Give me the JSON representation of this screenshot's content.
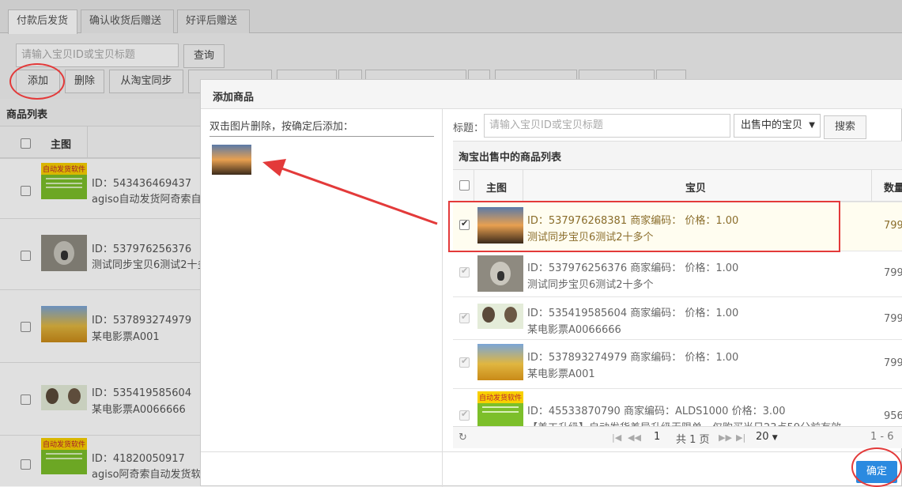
{
  "tabs": [
    "付款后发货",
    "确认收货后赠送",
    "好评后赠送"
  ],
  "search": {
    "placeholder": "请输入宝贝ID或宝贝标题",
    "query_label": "查询"
  },
  "toolbar": {
    "add": "添加",
    "delete": "删除",
    "sync": "从淘宝同步"
  },
  "left_panel": {
    "title": "商品列表",
    "header_img": "主图",
    "rows": [
      {
        "id": "ID：543436469437",
        "title": "agiso自动发货阿奇索自"
      },
      {
        "id": "ID：537976256376",
        "title": "测试同步宝贝6测试2十多"
      },
      {
        "id": "ID：537893274979",
        "title": "某电影票A001"
      },
      {
        "id": "ID：535419585604",
        "title": "某电影票A0066666"
      },
      {
        "id": "ID：41820050917",
        "title": "agiso阿奇索自动发货软"
      }
    ]
  },
  "dialog": {
    "title": "添加商品",
    "hint": "双击图片删除，按确定后添加：",
    "label_title": "标题：",
    "title_placeholder": "请输入宝贝ID或宝贝标题",
    "select_value": "出售中的宝贝",
    "search_btn": "搜索",
    "list_title": "淘宝出售中的商品列表",
    "col_img": "主图",
    "col_item": "宝贝",
    "col_qty": "数量",
    "rows": [
      {
        "line1": "ID：537976268381    商家编码：    价格：1.00",
        "line2": "测试同步宝贝6测试2十多个",
        "qty": "799"
      },
      {
        "line1": "ID：537976256376    商家编码：    价格：1.00",
        "line2": "测试同步宝贝6测试2十多个",
        "qty": "799"
      },
      {
        "line1": "ID：535419585604    商家编码：    价格：1.00",
        "line2": "某电影票A0066666",
        "qty": "799"
      },
      {
        "line1": "ID：537893274979    商家编码：    价格：1.00",
        "line2": "某电影票A001",
        "qty": "799"
      },
      {
        "line1": "ID：45533870790    商家编码：ALDS1000    价格：3.00",
        "line2": "【美工升级】自动发货差异升级无限单，仅购买当日23点59分前有效",
        "qty": "956"
      }
    ],
    "pager": {
      "page": "1",
      "total": "共 1 页",
      "size": "20",
      "range": "1 - 6"
    },
    "confirm": "确定"
  },
  "thumb_labels": {
    "software": "自动发货软件"
  },
  "colors": {
    "highlight_row": "#fffdf0",
    "annotation_red": "#e33a3a",
    "confirm_blue": "#2b8ae0"
  }
}
